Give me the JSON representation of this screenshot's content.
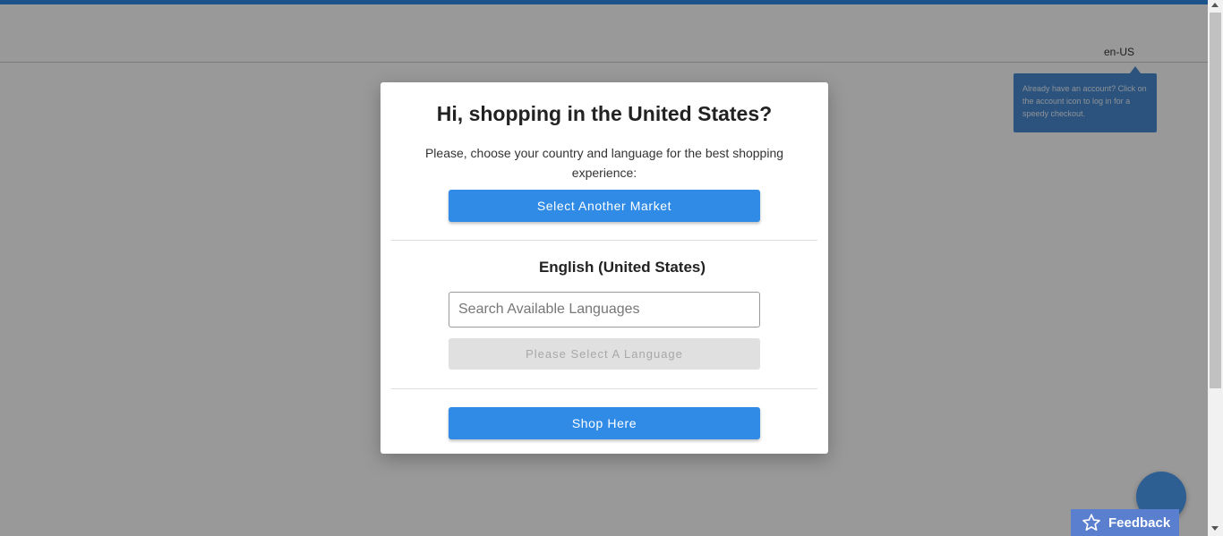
{
  "header": {
    "language_code": "en-US",
    "tooltip_text": "Already have an account? Click on the account icon to log in for a speedy checkout."
  },
  "modal": {
    "title": "Hi, shopping in the United States?",
    "subtitle": "Please, choose your country and language for the best shopping experience:",
    "select_market_label": "Select Another Market",
    "current_language": "English (United States)",
    "search_placeholder": "Search Available Languages",
    "select_language_label": "Please Select A Language",
    "shop_here_label": "Shop Here"
  },
  "feedback": {
    "label": "Feedback",
    "icon": "star-icon"
  },
  "chat": {
    "icon": "chat-bubble-icon"
  },
  "colors": {
    "accent": "#2f8be6",
    "tooltip": "#4a8ad3",
    "feedback": "#5a7fcf",
    "chat": "#2d5f93"
  }
}
